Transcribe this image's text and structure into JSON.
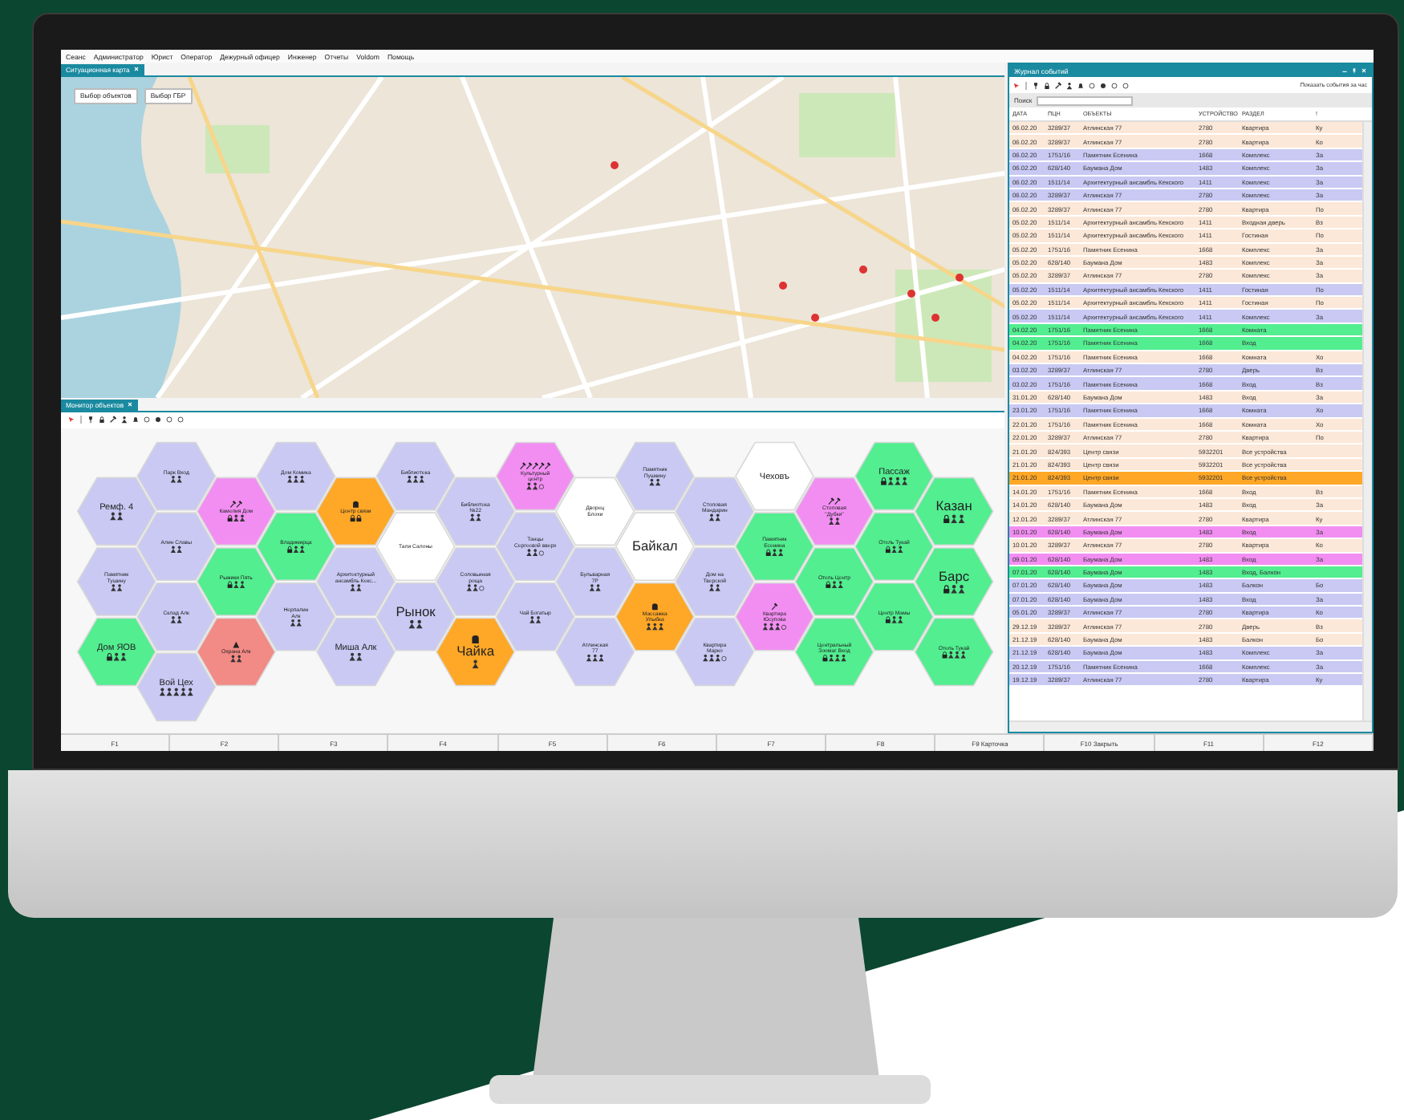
{
  "menu": [
    "Сеанс",
    "Администратор",
    "Юрист",
    "Оператор",
    "Дежурный офицер",
    "Инженер",
    "Отчеты",
    "Voldom",
    "Помощь"
  ],
  "map_panel": {
    "tab": "Ситуационная карта",
    "buttons": [
      "Выбор объектов",
      "Выбор ГБР"
    ]
  },
  "monitor_panel": {
    "tab": "Монитор объектов",
    "hex_columns": [
      [
        {
          "label": "Ремф. 4",
          "kind": "medium",
          "color": "#c9c9f4",
          "icons": [
            {
              "kind": "person"
            },
            {
              "kind": "person"
            }
          ]
        },
        {
          "label": "Памятник Тушину",
          "kind": "small",
          "color": "#c9c9f4",
          "icons": [
            {
              "kind": "person"
            },
            {
              "kind": "person"
            }
          ]
        },
        {
          "label": "Дом ЯОВ",
          "kind": "medium",
          "color": "#52ee90",
          "icons": [
            {
              "kind": "lock"
            },
            {
              "kind": "person"
            },
            {
              "kind": "person"
            }
          ]
        }
      ],
      [
        {
          "label": "Парк Вход",
          "kind": "small",
          "color": "#c9c9f4",
          "icons": [
            {
              "kind": "person"
            },
            {
              "kind": "person"
            }
          ]
        },
        {
          "label": "Алин Славы",
          "kind": "small",
          "color": "#c9c9f4",
          "icons": [
            {
              "kind": "person"
            },
            {
              "kind": "person"
            }
          ]
        },
        {
          "label": "Склад Алк",
          "kind": "small",
          "color": "#c9c9f4",
          "icons": [
            {
              "kind": "person"
            },
            {
              "kind": "person"
            }
          ]
        },
        {
          "label": "Вой Цех",
          "kind": "medium",
          "color": "#c9c9f4",
          "icons": [
            {
              "kind": "person"
            },
            {
              "kind": "person"
            },
            {
              "kind": "person"
            },
            {
              "kind": "person"
            },
            {
              "kind": "person"
            }
          ]
        }
      ],
      [
        {
          "label": "Камелия Дом",
          "kind": "small",
          "color": "#f28ef2",
          "top_icons": [
            {
              "kind": "tool"
            },
            {
              "kind": "tool"
            }
          ],
          "icons": [
            {
              "kind": "lock"
            },
            {
              "kind": "person"
            },
            {
              "kind": "person"
            }
          ]
        },
        {
          "label": "Рыжики Пять",
          "kind": "small",
          "color": "#52ee90",
          "icons": [
            {
              "kind": "lock"
            },
            {
              "kind": "person"
            },
            {
              "kind": "person"
            }
          ]
        },
        {
          "label": "Охрана Алк",
          "kind": "small",
          "color": "#f28a86",
          "top_icons": [
            {
              "kind": "warning"
            }
          ],
          "icons": [
            {
              "kind": "person"
            },
            {
              "kind": "person"
            }
          ]
        }
      ],
      [
        {
          "label": "Дом Комика",
          "kind": "small",
          "color": "#c9c9f4",
          "icons": [
            {
              "kind": "person"
            },
            {
              "kind": "person"
            },
            {
              "kind": "person"
            }
          ]
        },
        {
          "label": "Владимирца",
          "kind": "small",
          "color": "#52ee90",
          "icons": [
            {
              "kind": "lock"
            },
            {
              "kind": "person"
            },
            {
              "kind": "person"
            }
          ]
        },
        {
          "label": "Нерпалин Алк",
          "kind": "small",
          "color": "#c9c9f4",
          "icons": [
            {
              "kind": "person"
            },
            {
              "kind": "person"
            }
          ]
        }
      ],
      [
        {
          "label": "Центр связи",
          "kind": "small",
          "color": "#ffa726",
          "top_icons": [
            {
              "kind": "hand"
            }
          ],
          "icons": [
            {
              "kind": "lock"
            },
            {
              "kind": "lock"
            }
          ]
        },
        {
          "label": "Архитектурный ансамбль Кекс...",
          "kind": "small",
          "color": "#c9c9f4",
          "icons": [
            {
              "kind": "person"
            },
            {
              "kind": "person"
            }
          ]
        },
        {
          "label": "Миша Алк",
          "kind": "medium",
          "color": "#c9c9f4",
          "icons": [
            {
              "kind": "person"
            },
            {
              "kind": "person"
            }
          ]
        }
      ],
      [
        {
          "label": "Библиотека",
          "kind": "small",
          "color": "#c9c9f4",
          "icons": [
            {
              "kind": "person"
            },
            {
              "kind": "person"
            },
            {
              "kind": "person"
            }
          ]
        },
        {
          "label": "Тали Салоны",
          "kind": "small",
          "color": "#ffffff"
        },
        {
          "label": "Рынок",
          "kind": "large",
          "color": "#c9c9f4",
          "icons": [
            {
              "kind": "person"
            },
            {
              "kind": "person"
            }
          ]
        }
      ],
      [
        {
          "label": "Библиотека №22",
          "kind": "small",
          "color": "#c9c9f4",
          "icons": [
            {
              "kind": "person"
            },
            {
              "kind": "person"
            }
          ]
        },
        {
          "label": "Соловьиная роща",
          "kind": "small",
          "color": "#c9c9f4",
          "icons": [
            {
              "kind": "person"
            },
            {
              "kind": "person"
            },
            {
              "kind": "ring"
            }
          ]
        },
        {
          "label": "Чайка",
          "kind": "large",
          "color": "#ffa726",
          "top_icons": [
            {
              "kind": "hand"
            }
          ],
          "icons": [
            {
              "kind": "person"
            }
          ]
        }
      ],
      [
        {
          "label": "Культурный центр",
          "kind": "small",
          "color": "#f28ef2",
          "top_icons": [
            {
              "kind": "tool"
            },
            {
              "kind": "tool"
            },
            {
              "kind": "tool"
            },
            {
              "kind": "tool"
            },
            {
              "kind": "tool"
            }
          ],
          "icons": [
            {
              "kind": "person"
            },
            {
              "kind": "person"
            },
            {
              "kind": "ring"
            }
          ]
        },
        {
          "label": "Танцы Сергеевой вверх",
          "kind": "small",
          "color": "#c9c9f4",
          "icons": [
            {
              "kind": "person"
            },
            {
              "kind": "person"
            },
            {
              "kind": "ring"
            }
          ]
        },
        {
          "label": "Чай Богатыр",
          "kind": "small",
          "color": "#c9c9f4",
          "icons": [
            {
              "kind": "person"
            },
            {
              "kind": "person"
            }
          ]
        }
      ],
      [
        {
          "label": "Дворец Блохи",
          "kind": "small",
          "color": "#ffffff"
        },
        {
          "label": "Бульварная 7Р",
          "kind": "small",
          "color": "#c9c9f4",
          "icons": [
            {
              "kind": "person"
            },
            {
              "kind": "person"
            }
          ]
        },
        {
          "label": "Атлинская 77",
          "kind": "small",
          "color": "#c9c9f4",
          "icons": [
            {
              "kind": "person"
            },
            {
              "kind": "person"
            },
            {
              "kind": "person"
            }
          ]
        }
      ],
      [
        {
          "label": "Памятник Пушкину",
          "kind": "small",
          "color": "#c9c9f4",
          "icons": [
            {
              "kind": "person"
            },
            {
              "kind": "person"
            }
          ]
        },
        {
          "label": "Байкал",
          "kind": "large",
          "color": "#ffffff"
        },
        {
          "label": "Массажка Улыбка",
          "kind": "small",
          "color": "#ffa726",
          "top_icons": [
            {
              "kind": "hand"
            }
          ],
          "icons": [
            {
              "kind": "person"
            },
            {
              "kind": "person"
            },
            {
              "kind": "person"
            }
          ]
        }
      ],
      [
        {
          "label": "Столовая Мандарин",
          "kind": "small",
          "color": "#c9c9f4",
          "icons": [
            {
              "kind": "person"
            },
            {
              "kind": "person"
            }
          ]
        },
        {
          "label": "Дом на Тверской",
          "kind": "small",
          "color": "#c9c9f4",
          "icons": [
            {
              "kind": "person"
            },
            {
              "kind": "person"
            }
          ]
        },
        {
          "label": "Квартира Марко",
          "kind": "small",
          "color": "#c9c9f4",
          "icons": [
            {
              "kind": "person"
            },
            {
              "kind": "person"
            },
            {
              "kind": "person"
            },
            {
              "kind": "ring"
            }
          ]
        }
      ],
      [
        {
          "label": "Чеховъ",
          "kind": "medium",
          "color": "#ffffff"
        },
        {
          "label": "Памятник Есенина",
          "kind": "small",
          "color": "#52ee90",
          "icons": [
            {
              "kind": "lock"
            },
            {
              "kind": "person"
            },
            {
              "kind": "person"
            }
          ]
        },
        {
          "label": "Квартира Юсупова",
          "kind": "small",
          "color": "#f28ef2",
          "top_icons": [
            {
              "kind": "tool"
            }
          ],
          "icons": [
            {
              "kind": "person"
            },
            {
              "kind": "person"
            },
            {
              "kind": "person"
            },
            {
              "kind": "ring"
            }
          ]
        }
      ],
      [
        {
          "label": "Столовая \"Дубки\"",
          "kind": "small",
          "color": "#f28ef2",
          "top_icons": [
            {
              "kind": "tool"
            },
            {
              "kind": "tool"
            }
          ],
          "icons": [
            {
              "kind": "person"
            },
            {
              "kind": "person"
            }
          ]
        },
        {
          "label": "Отель Центр",
          "kind": "small",
          "color": "#52ee90",
          "icons": [
            {
              "kind": "lock"
            },
            {
              "kind": "person"
            },
            {
              "kind": "person"
            }
          ]
        },
        {
          "label": "Центральный Зоомаг Вход",
          "kind": "small",
          "color": "#52ee90",
          "icons": [
            {
              "kind": "lock"
            },
            {
              "kind": "person"
            },
            {
              "kind": "person"
            },
            {
              "kind": "person"
            }
          ]
        }
      ],
      [
        {
          "label": "Пассаж",
          "kind": "medium",
          "color": "#52ee90",
          "icons": [
            {
              "kind": "lock"
            },
            {
              "kind": "person"
            },
            {
              "kind": "person"
            },
            {
              "kind": "person"
            }
          ]
        },
        {
          "label": "Отель Тукай",
          "kind": "small",
          "color": "#52ee90",
          "icons": [
            {
              "kind": "lock"
            },
            {
              "kind": "person"
            },
            {
              "kind": "person"
            }
          ]
        },
        {
          "label": "Центр Мамы",
          "kind": "small",
          "color": "#52ee90",
          "icons": [
            {
              "kind": "lock"
            },
            {
              "kind": "person"
            },
            {
              "kind": "person"
            }
          ]
        }
      ],
      [
        {
          "label": "Казан",
          "kind": "large",
          "color": "#52ee90",
          "icons": [
            {
              "kind": "lock"
            },
            {
              "kind": "person"
            },
            {
              "kind": "person"
            }
          ]
        },
        {
          "label": "Барс",
          "kind": "large",
          "color": "#52ee90",
          "icons": [
            {
              "kind": "lock"
            },
            {
              "kind": "person"
            },
            {
              "kind": "person"
            }
          ]
        },
        {
          "label": "Отель Тукай",
          "kind": "small",
          "color": "#52ee90",
          "icons": [
            {
              "kind": "lock"
            },
            {
              "kind": "person"
            },
            {
              "kind": "person"
            },
            {
              "kind": "person"
            }
          ]
        }
      ]
    ]
  },
  "event_log": {
    "title": "Журнал событий",
    "filter_label": "Показать события за час",
    "search_label": "Поиск",
    "columns": [
      "ДАТА",
      "ПЦН",
      "ОБЪЕКТЫ",
      "УСТРОЙСТВО",
      "РАЗДЕЛ",
      "!"
    ],
    "rows": [
      {
        "cells": [
          "06.02.20",
          "3289/37",
          "Атлинская 77",
          "2780",
          "Квартира",
          "Ку"
        ],
        "color": "#fce8d8"
      },
      {
        "cells": [
          "06.02.20",
          "3289/37",
          "Атлинская 77",
          "2780",
          "Квартира",
          "Ко"
        ],
        "color": "#fce8d8"
      },
      {
        "cells": [
          "06.02.20",
          "1751/16",
          "Памятник Есенина",
          "1668",
          "Комплекс",
          "За"
        ],
        "color": "#c9c9f4"
      },
      {
        "cells": [
          "06.02.20",
          "628/140",
          "Баумана Дом",
          "1483",
          "Комплекс",
          "За"
        ],
        "color": "#c9c9f4"
      },
      {
        "cells": [
          "06.02.20",
          "1511/14",
          "Архитектурный ансамбль Кекского",
          "1411",
          "Комплекс",
          "За"
        ],
        "color": "#c9c9f4"
      },
      {
        "cells": [
          "06.02.20",
          "3289/37",
          "Атлинская 77",
          "2780",
          "Комплекс",
          "За"
        ],
        "color": "#c9c9f4"
      },
      {
        "cells": [
          "06.02.20",
          "3289/37",
          "Атлинская 77",
          "2780",
          "Квартира",
          "По"
        ],
        "color": "#fce8d8"
      },
      {
        "cells": [
          "05.02.20",
          "1511/14",
          "Архитектурный ансамбль Кекского",
          "1411",
          "Входная дверь",
          "Вз"
        ],
        "color": "#fce8d8"
      },
      {
        "cells": [
          "05.02.20",
          "1511/14",
          "Архитектурный ансамбль Кекского",
          "1411",
          "Гостиная",
          "По"
        ],
        "color": "#fce8d8"
      },
      {
        "cells": [
          "05.02.20",
          "1751/16",
          "Памятник Есенина",
          "1668",
          "Комплекс",
          "За"
        ],
        "color": "#fce8d8"
      },
      {
        "cells": [
          "05.02.20",
          "628/140",
          "Баумана Дом",
          "1483",
          "Комплекс",
          "За"
        ],
        "color": "#fce8d8"
      },
      {
        "cells": [
          "05.02.20",
          "3289/37",
          "Атлинская 77",
          "2780",
          "Комплекс",
          "За"
        ],
        "color": "#fce8d8"
      },
      {
        "cells": [
          "05.02.20",
          "1511/14",
          "Архитектурный ансамбль Кекского",
          "1411",
          "Гостиная",
          "По"
        ],
        "color": "#c9c9f4"
      },
      {
        "cells": [
          "05.02.20",
          "1511/14",
          "Архитектурный ансамбль Кекского",
          "1411",
          "Гостиная",
          "По"
        ],
        "color": "#fce8d8"
      },
      {
        "cells": [
          "05.02.20",
          "1511/14",
          "Архитектурный ансамбль Кекского",
          "1411",
          "Комплекс",
          "За"
        ],
        "color": "#c9c9f4"
      },
      {
        "cells": [
          "04.02.20",
          "1751/16",
          "Памятник Есенина",
          "1668",
          "Комната"
        ],
        "color": "#52ee90"
      },
      {
        "cells": [
          "04.02.20",
          "1751/16",
          "Памятник Есенина",
          "1668",
          "Вход"
        ],
        "color": "#52ee90"
      },
      {
        "cells": [
          "04.02.20",
          "1751/16",
          "Памятник Есенина",
          "1668",
          "Комната",
          "Хо"
        ],
        "color": "#fce8d8"
      },
      {
        "cells": [
          "03.02.20",
          "3289/37",
          "Атлинская 77",
          "2780",
          "Дверь",
          "Вз"
        ],
        "color": "#c9c9f4"
      },
      {
        "cells": [
          "03.02.20",
          "1751/16",
          "Памятник Есенина",
          "1668",
          "Вход",
          "Вз"
        ],
        "color": "#c9c9f4"
      },
      {
        "cells": [
          "31.01.20",
          "628/140",
          "Баумана Дом",
          "1483",
          "Вход",
          "За"
        ],
        "color": "#fce8d8"
      },
      {
        "cells": [
          "23.01.20",
          "1751/16",
          "Памятник Есенина",
          "1668",
          "Комната",
          "Хо"
        ],
        "color": "#c9c9f4"
      },
      {
        "cells": [
          "22.01.20",
          "1751/16",
          "Памятник Есенина",
          "1668",
          "Комната",
          "Хо"
        ],
        "color": "#fce8d8"
      },
      {
        "cells": [
          "22.01.20",
          "3289/37",
          "Атлинская 77",
          "2780",
          "Квартира",
          "По"
        ],
        "color": "#fce8d8"
      },
      {
        "cells": [
          "21.01.20",
          "824/393",
          "Центр связи",
          "5932201",
          "Все устройства"
        ],
        "color": "#fce8d8"
      },
      {
        "cells": [
          "21.01.20",
          "824/393",
          "Центр связи",
          "5932201",
          "Все устройства"
        ],
        "color": "#fce8d8"
      },
      {
        "cells": [
          "21.01.20",
          "824/393",
          "Центр связи",
          "5932201",
          "Все устройства"
        ],
        "color": "#ffa726"
      },
      {
        "cells": [
          "14.01.20",
          "1751/16",
          "Памятник Есенина",
          "1668",
          "Вход",
          "Вз"
        ],
        "color": "#fce8d8"
      },
      {
        "cells": [
          "14.01.20",
          "628/140",
          "Баумана Дом",
          "1483",
          "Вход",
          "За"
        ],
        "color": "#fce8d8"
      },
      {
        "cells": [
          "12.01.20",
          "3289/37",
          "Атлинская 77",
          "2780",
          "Квартира",
          "Ку"
        ],
        "color": "#fce8d8"
      },
      {
        "cells": [
          "10.01.20",
          "628/140",
          "Баумана Дом",
          "1483",
          "Вход",
          "За"
        ],
        "color": "#f28ef2"
      },
      {
        "cells": [
          "10.01.20",
          "3289/37",
          "Атлинская 77",
          "2780",
          "Квартира",
          "Ко"
        ],
        "color": "#fce8d8"
      },
      {
        "cells": [
          "09.01.20",
          "628/140",
          "Баумана Дом",
          "1483",
          "Вход",
          "За"
        ],
        "color": "#f28ef2"
      },
      {
        "cells": [
          "07.01.20",
          "628/140",
          "Баумана Дом",
          "1483",
          "Вход, Балкон"
        ],
        "color": "#52ee90"
      },
      {
        "cells": [
          "07.01.20",
          "628/140",
          "Баумана Дом",
          "1483",
          "Балкон",
          "Бо"
        ],
        "color": "#c9c9f4"
      },
      {
        "cells": [
          "07.01.20",
          "628/140",
          "Баумана Дом",
          "1483",
          "Вход",
          "За"
        ],
        "color": "#c9c9f4"
      },
      {
        "cells": [
          "05.01.20",
          "3289/37",
          "Атлинская 77",
          "2780",
          "Квартира",
          "Ко"
        ],
        "color": "#c9c9f4"
      },
      {
        "cells": [
          "29.12.19",
          "3289/37",
          "Атлинская 77",
          "2780",
          "Дверь",
          "Вз"
        ],
        "color": "#fce8d8"
      },
      {
        "cells": [
          "21.12.19",
          "628/140",
          "Баумана Дом",
          "1483",
          "Балкон",
          "Бо"
        ],
        "color": "#fce8d8"
      },
      {
        "cells": [
          "21.12.19",
          "628/140",
          "Баумана Дом",
          "1483",
          "Комплекс",
          "За"
        ],
        "color": "#c9c9f4"
      },
      {
        "cells": [
          "20.12.19",
          "1751/16",
          "Памятник Есенина",
          "1668",
          "Комплекс",
          "За"
        ],
        "color": "#c9c9f4"
      },
      {
        "cells": [
          "19.12.19",
          "3289/37",
          "Атлинская 77",
          "2780",
          "Квартира",
          "Ку"
        ],
        "color": "#c9c9f4"
      }
    ]
  },
  "function_keys": [
    "F1",
    "F2",
    "F3",
    "F4",
    "F5",
    "F6",
    "F7",
    "F8",
    "F9 Карточка",
    "F10 Закрыть",
    "F11",
    "F12"
  ]
}
